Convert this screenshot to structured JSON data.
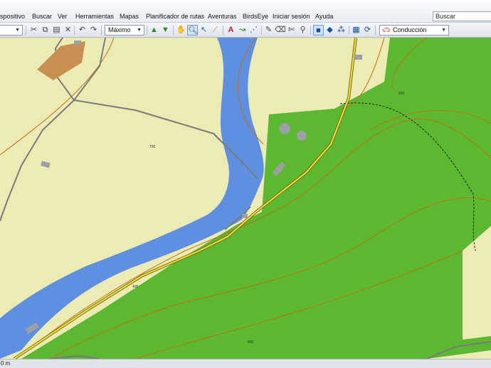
{
  "menu": {
    "items": [
      "spositivo",
      "Buscar",
      "Ver",
      "Herramientas",
      "Mapas",
      "Planificador de rutas",
      "Aventuras",
      "BirdsEye",
      "Iniciar sesión",
      "Ayuda"
    ]
  },
  "search": {
    "placeholder": "Buscar"
  },
  "toolbar": {
    "zoom_label": "Máximo",
    "profile_label": "Conducción",
    "icons": [
      "cut-icon",
      "copy-icon",
      "paste-icon",
      "delete-icon",
      "undo-icon",
      "redo-icon",
      "send-to-device-icon",
      "receive-from-device-icon",
      "hand-pan-icon",
      "zoom-icon",
      "select-arrow-icon",
      "measure-ruler-icon",
      "new-waypoint-icon",
      "new-route-icon",
      "new-track-icon",
      "edit-icon",
      "erase-icon",
      "divide-icon",
      "view-2d-icon",
      "view-3d-icon",
      "map-layers-icon",
      "grid-icon",
      "refresh-icon",
      "car-icon"
    ]
  },
  "map": {
    "labels": [
      "700",
      "600",
      "400",
      "400"
    ],
    "colors": {
      "river": "#5f8fe0",
      "forest": "#5cb830",
      "land": "#ecebb4",
      "road": "#f2e23a",
      "contour": "#c0701a"
    }
  },
  "status": {
    "scale": "0 m"
  }
}
